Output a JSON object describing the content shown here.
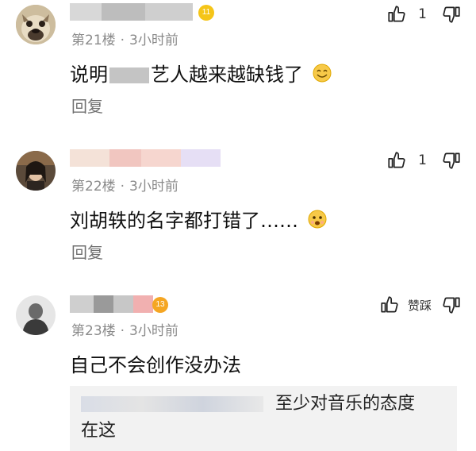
{
  "comments": [
    {
      "floor": "第21楼",
      "time": "3小时前",
      "level": "11",
      "text_before": "说明",
      "text_after": "艺人越来越缺钱了",
      "emoji": "smile-emoji",
      "reply_label": "回复",
      "likes": "1"
    },
    {
      "floor": "第22楼",
      "time": "3小时前",
      "text": "刘胡轶的名字都打错了……",
      "emoji": "shock-emoji",
      "reply_label": "回复",
      "likes": "1"
    },
    {
      "floor": "第23楼",
      "time": "3小时前",
      "level": "13",
      "text": "自己不会创作没办法",
      "like_label": "赞",
      "dislike_label": "踩",
      "quote": {
        "text": "至少对音乐的态度",
        "text_line2": "在这"
      }
    }
  ],
  "separator_dot": "·",
  "colors": {
    "badge": "#f5c518",
    "badge13": "#f5a623",
    "meta": "#8a8a8a",
    "quote_bg": "#f2f2f2"
  }
}
